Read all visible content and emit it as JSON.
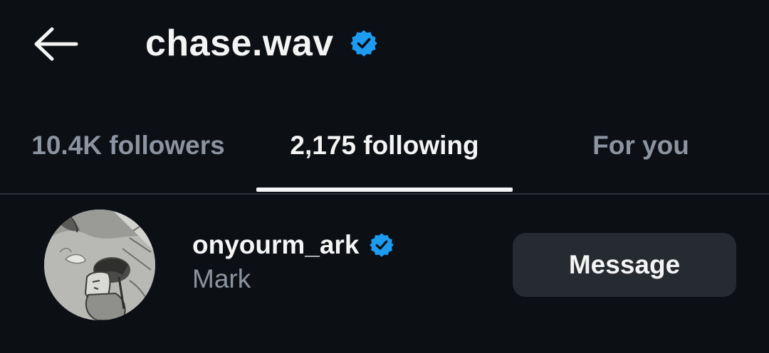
{
  "header": {
    "back_icon": "arrow-left-icon",
    "title": "chase.wav",
    "verified_icon": "verified-badge-icon"
  },
  "tabs": [
    {
      "label": "10.4K followers",
      "active": false
    },
    {
      "label": "2,175 following",
      "active": true
    },
    {
      "label": "For you",
      "active": false
    }
  ],
  "users": [
    {
      "username": "onyourm_ark",
      "verified": true,
      "display_name": "Mark",
      "action_label": "Message",
      "avatar": "avatar-sketch-image"
    }
  ],
  "colors": {
    "background": "#0c0f14",
    "verified_blue": "#1d9bf0",
    "muted_text": "#8b94a0",
    "button_bg": "#262a31",
    "divider": "#2b2f36"
  }
}
